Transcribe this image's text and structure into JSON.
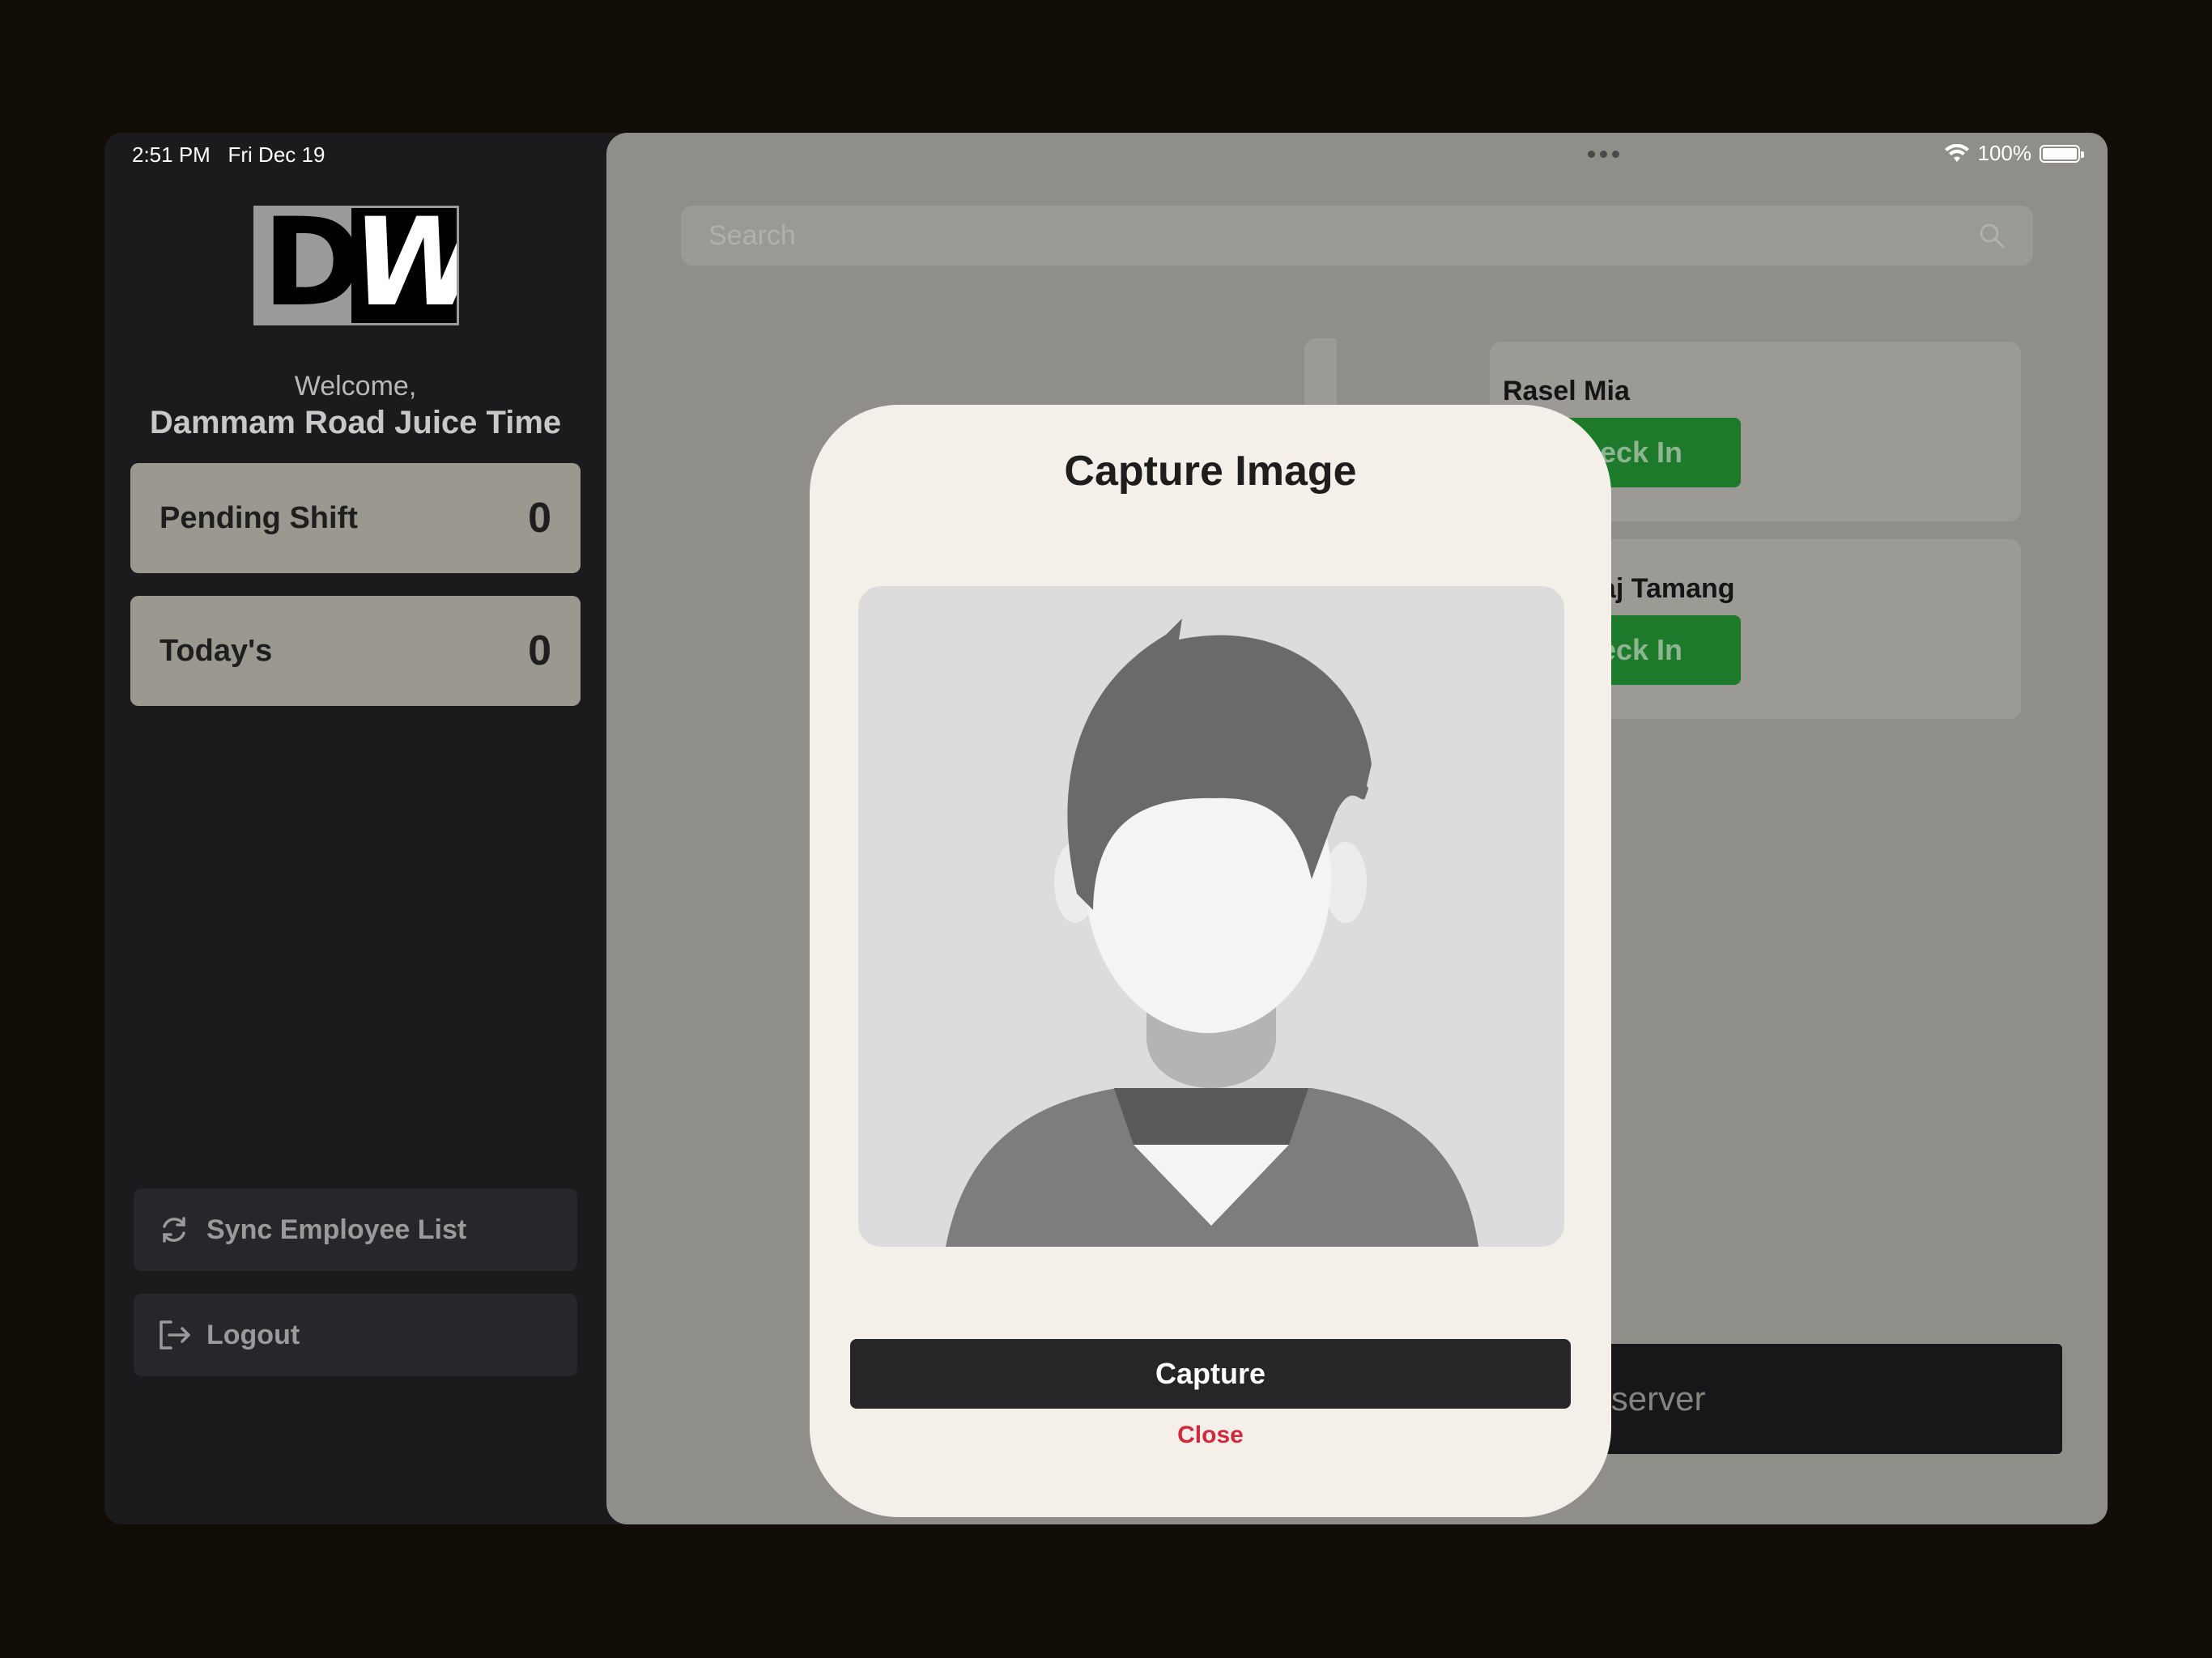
{
  "status_bar": {
    "time": "2:51 PM",
    "date": "Fri Dec 19",
    "battery": "100%"
  },
  "sidebar": {
    "logo_text_d": "D",
    "logo_text_w": "W",
    "welcome": "Welcome,",
    "store_name": "Dammam Road Juice Time",
    "stats": [
      {
        "label": "Pending Shift",
        "value": "0"
      },
      {
        "label": "Today's",
        "value": "0"
      }
    ],
    "actions": [
      {
        "label": "Sync Employee List",
        "icon": "sync-icon"
      },
      {
        "label": "Logout",
        "icon": "logout-icon"
      }
    ]
  },
  "main": {
    "search_placeholder": "Search",
    "employees": [
      {
        "name": "Rasel Mia",
        "action": "Check In"
      },
      {
        "name": "Mekh Raj Tamang",
        "action": "Check In"
      }
    ],
    "push_label": "Push Records to the server"
  },
  "modal": {
    "title": "Capture Image",
    "capture_label": "Capture",
    "close_label": "Close"
  },
  "colors": {
    "accent_green": "#1e7a2b",
    "danger_red": "#d2283d",
    "dark_button": "#272527"
  }
}
